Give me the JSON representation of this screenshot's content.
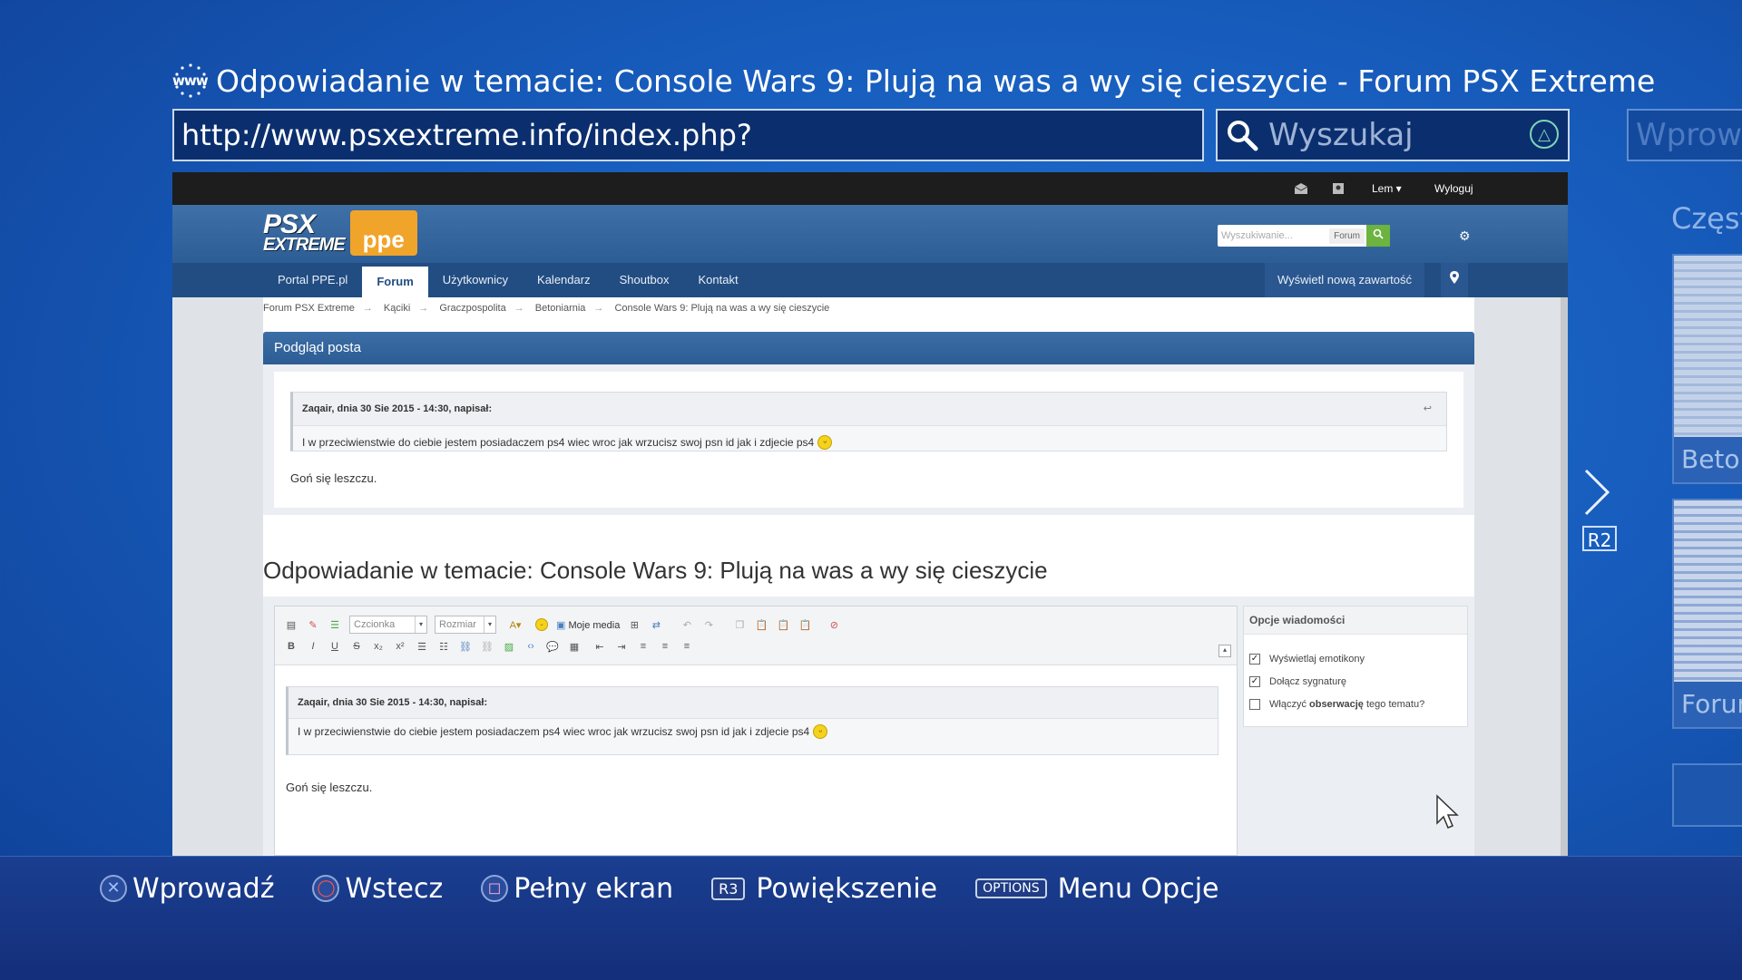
{
  "browser": {
    "page_title": "Odpowiadanie w temacie: Console Wars 9: Plują na was a wy się cieszycie - Forum PSX Extreme",
    "url": "http://www.psxextreme.info/index.php?",
    "search_placeholder": "Wyszukaj",
    "next_tab_placeholder": "Wprowa",
    "side_heading": "Częst",
    "thumbnails": [
      {
        "caption": "Beton"
      },
      {
        "caption": "Forum"
      }
    ],
    "r2_label": "R2"
  },
  "site": {
    "userbar": {
      "user_label": "Lem",
      "logout_label": "Wyloguj"
    },
    "logo": {
      "main": "PSX",
      "sub": "EXTREME",
      "badge": "ppe"
    },
    "search": {
      "placeholder": "Wyszukiwanie...",
      "scope": "Forum"
    },
    "nav": {
      "tabs": [
        "Portal PPE.pl",
        "Forum",
        "Użytkownicy",
        "Kalendarz",
        "Shoutbox",
        "Kontakt"
      ],
      "active_tab": "Forum",
      "new_content_label": "Wyświetl nową zawartość"
    },
    "breadcrumbs": [
      "Forum PSX Extreme",
      "Kąciki",
      "Graczpospolita",
      "Betoniarnia",
      "Console Wars 9: Plują na was a wy się cieszycie"
    ],
    "preview": {
      "heading": "Podgląd posta",
      "quote_header": "Zaqair, dnia 30 Sie 2015 - 14:30, napisał:",
      "quote_text": "I w przeciwienstwie do ciebie jestem posiadaczem ps4 wiec wroc jak wrzucisz swoj psn id jak i zdjecie ps4",
      "reply_text": "Goń się leszczu."
    },
    "reply": {
      "title": "Odpowiadanie w temacie: Console Wars 9: Plują na was a wy się cieszycie",
      "font_combo": "Czcionka",
      "size_combo": "Rozmiar",
      "my_media": "Moje media",
      "quote_header": "Zaqair, dnia 30 Sie 2015 - 14:30, napisał:",
      "quote_text": "I w przeciwienstwie do ciebie jestem posiadaczem ps4 wiec wroc jak wrzucisz swoj psn id jak i zdjecie ps4",
      "body_text": "Goń się leszczu."
    },
    "options": {
      "heading": "Opcje wiadomości",
      "items": [
        {
          "label": "Wyświetlaj emotikony",
          "checked": true
        },
        {
          "label": "Dołącz sygnaturę",
          "checked": true
        },
        {
          "label_pre": "Włączyć ",
          "label_bold": "obserwację",
          "label_post": " tego tematu?",
          "checked": false
        }
      ]
    }
  },
  "bottom_bar": {
    "enter": "Wprowadź",
    "back": "Wstecz",
    "fullscreen": "Pełny ekran",
    "zoom_key": "R3",
    "zoom": "Powiększenie",
    "options_key": "OPTIONS",
    "options": "Menu Opcje"
  },
  "colors": {
    "ps_blue": "#175cbc",
    "site_header": "#2d5d95",
    "site_nav": "#224d82",
    "search_go": "#6cb33f"
  }
}
